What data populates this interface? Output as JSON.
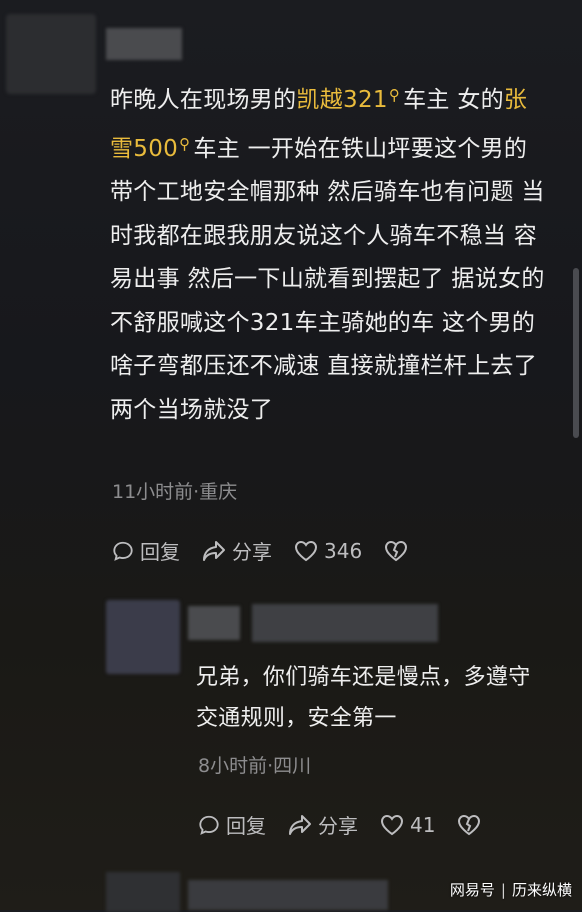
{
  "comment": {
    "text_before_kw1": "昨晚人在现场男的",
    "keyword1": "凯越321",
    "text_after_kw1": "车主 女的",
    "keyword2": "张雪500",
    "text_after_kw2": "车主 一开始在铁山坪要这个男的带个工地安全帽那种 然后骑车也有问题 当时我都在跟我朋友说这个人骑车不稳当 容易出事 然后一下山就看到摆起了 据说女的不舒服喊这个321车主骑她的车 这个男的啥子弯都压还不减速 直接就撞栏杆上去了 两个当场就没了",
    "meta": "11小时前·重庆",
    "reply_label": "回复",
    "share_label": "分享",
    "like_count": "346"
  },
  "reply": {
    "text": "兄弟，你们骑车还是慢点，多遵守交通规则，安全第一",
    "meta": "8小时前·四川",
    "reply_label": "回复",
    "share_label": "分享",
    "like_count": "41"
  },
  "watermark": {
    "brand": "网易号",
    "author": "历来纵横"
  },
  "colors": {
    "keyword": "#e9bb3c",
    "background": "#1b1c20"
  }
}
